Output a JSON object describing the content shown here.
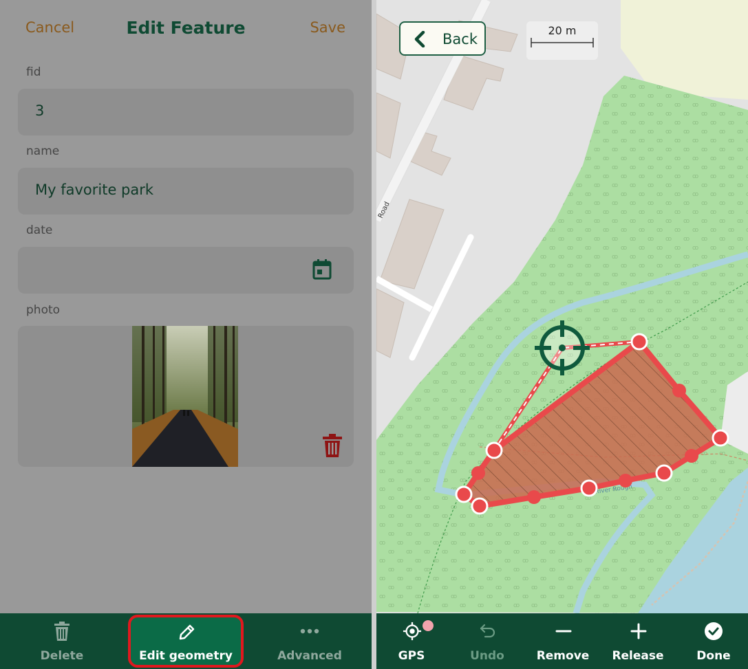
{
  "form": {
    "cancel_label": "Cancel",
    "title": "Edit Feature",
    "save_label": "Save",
    "fields": [
      {
        "label": "fid",
        "value": "3"
      },
      {
        "label": "name",
        "value": "My favorite park"
      },
      {
        "label": "date",
        "value": ""
      },
      {
        "label": "photo",
        "value": ""
      }
    ],
    "date_icon": "calendar-icon",
    "photo_delete_icon": "trash-icon"
  },
  "form_toolbar": {
    "items": [
      {
        "label": "Delete",
        "icon": "trash-icon"
      },
      {
        "label": "Edit geometry",
        "icon": "pencil-icon"
      },
      {
        "label": "Advanced",
        "icon": "more-horizontal-icon"
      }
    ]
  },
  "map": {
    "back_label": "Back",
    "scale_label": "20 m",
    "road_label": "Road",
    "path_label": "River Rough",
    "colors": {
      "park": "#a8d5a0",
      "water": "#aad3df",
      "building": "#d9d0c9",
      "polygon_fill": "#c96a4f",
      "polygon_stroke": "#e9494b",
      "crosshair": "#0f5a3d"
    }
  },
  "map_toolbar": {
    "items": [
      {
        "label": "GPS",
        "icon": "gps-icon"
      },
      {
        "label": "Undo",
        "icon": "undo-icon"
      },
      {
        "label": "Remove",
        "icon": "minus-icon"
      },
      {
        "label": "Release",
        "icon": "plus-icon"
      },
      {
        "label": "Done",
        "icon": "check-circle-icon"
      }
    ]
  }
}
